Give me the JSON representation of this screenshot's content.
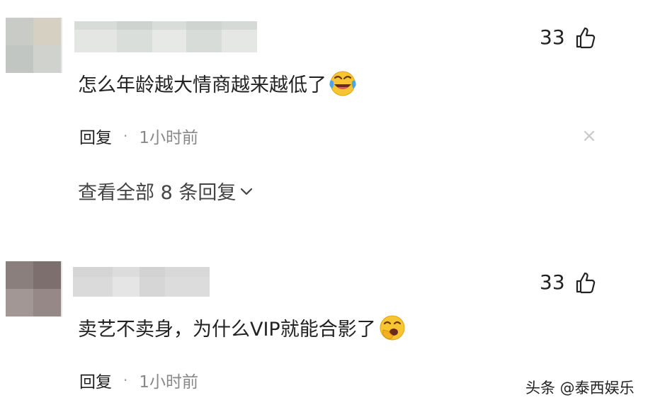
{
  "comments": [
    {
      "text": "怎么年龄越大情商越来越低了",
      "emoji": "laughing-crying-emoji",
      "likes": "33",
      "reply_label": "回复",
      "separator": "·",
      "time": "1小时前",
      "view_replies": "查看全部 8 条回复",
      "close_symbol": "×",
      "avatar_colors": [
        "#c9ccc6",
        "#d6d0c2",
        "#c2c6c2",
        "#cfd2cd"
      ]
    },
    {
      "text": "卖艺不卖身，为什么VIP就能合影了",
      "emoji": "yawning-emoji",
      "likes": "33",
      "reply_label": "回复",
      "separator": "·",
      "time": "1小时前",
      "avatar_colors": [
        "#8a7f7d",
        "#7d6f6e",
        "#a39795",
        "#958886"
      ]
    }
  ],
  "watermark": "头条 @泰西娱乐",
  "icons": {
    "like": "thumbs-up-icon",
    "chevron": "chevron-down-icon"
  }
}
